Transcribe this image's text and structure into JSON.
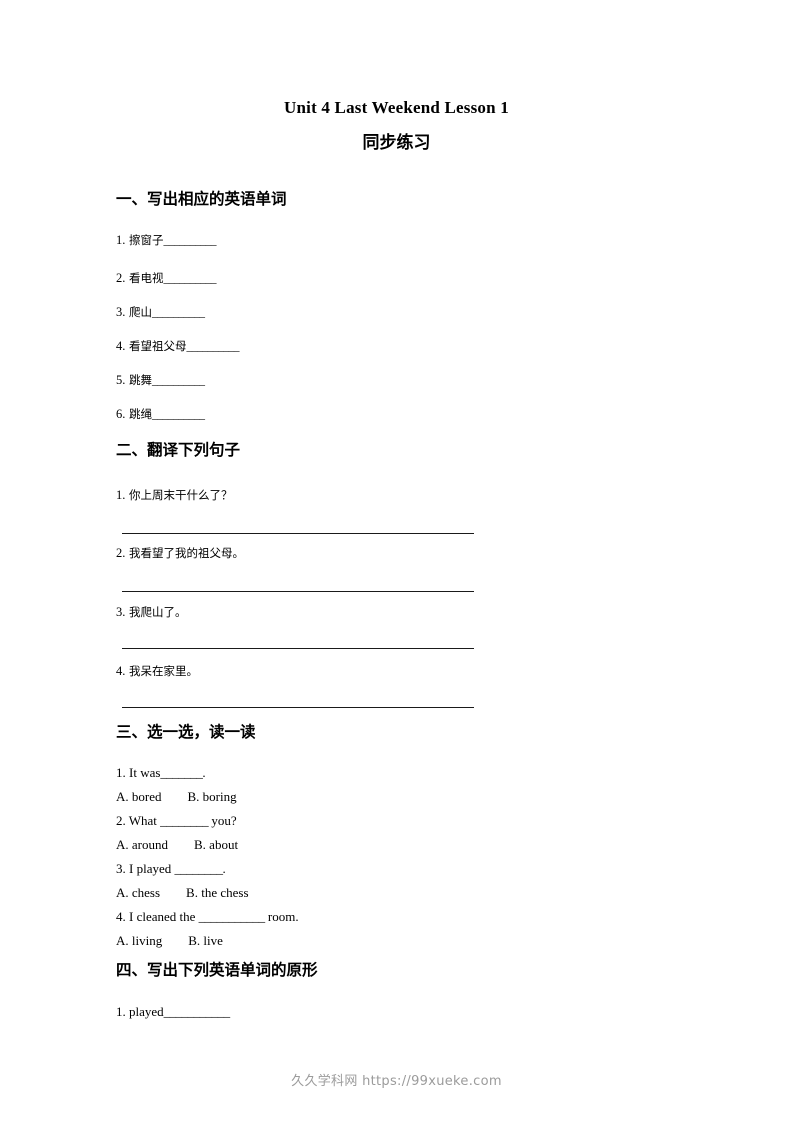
{
  "document": {
    "title": "Unit 4 Last Weekend Lesson 1",
    "subtitle": "同步练习"
  },
  "sections": [
    {
      "heading": "一、写出相应的英语单词",
      "items": [
        {
          "num": "1.",
          "text": "擦窗子",
          "blank": "__________"
        },
        {
          "num": "2.",
          "text": "看电视",
          "blank": "__________"
        },
        {
          "num": "3.",
          "text": "爬山",
          "blank": "__________"
        },
        {
          "num": "4.",
          "text": "看望祖父母",
          "blank": "__________"
        },
        {
          "num": "5.",
          "text": "跳舞",
          "blank": "__________"
        },
        {
          "num": "6.",
          "text": "跳绳",
          "blank": "__________"
        }
      ]
    },
    {
      "heading": "二、翻译下列句子",
      "items": [
        {
          "num": "1.",
          "text": "你上周末干什么了？"
        },
        {
          "num": "2.",
          "text": "我看望了我的祖父母。"
        },
        {
          "num": "3.",
          "text": "我爬山了。"
        },
        {
          "num": "4.",
          "text": "我呆在家里。"
        }
      ]
    },
    {
      "heading": "三、选一选，读一读",
      "questions": [
        {
          "prompt_before": "1. It was",
          "blank": "_______",
          "prompt_after": ".",
          "option_a": "A. bored",
          "option_b": "B. boring"
        },
        {
          "prompt_before": "2. What ",
          "blank": "________",
          "prompt_after": " you?",
          "option_a": "A. around",
          "option_b": "B. about"
        },
        {
          "prompt_before": "3. I played ",
          "blank": "________",
          "prompt_after": ".",
          "option_a": "A. chess",
          "option_b": "B. the chess"
        },
        {
          "prompt_before": "4. I cleaned the ",
          "blank": "___________",
          "prompt_after": " room.",
          "option_a": "A. living",
          "option_b": "B. live"
        }
      ]
    },
    {
      "heading": "四、写出下列英语单词的原形",
      "items": [
        {
          "num": "1.",
          "text": "played",
          "blank": "___________"
        }
      ]
    }
  ],
  "watermark": {
    "text": "久久学科网 https://99xueke.com"
  }
}
